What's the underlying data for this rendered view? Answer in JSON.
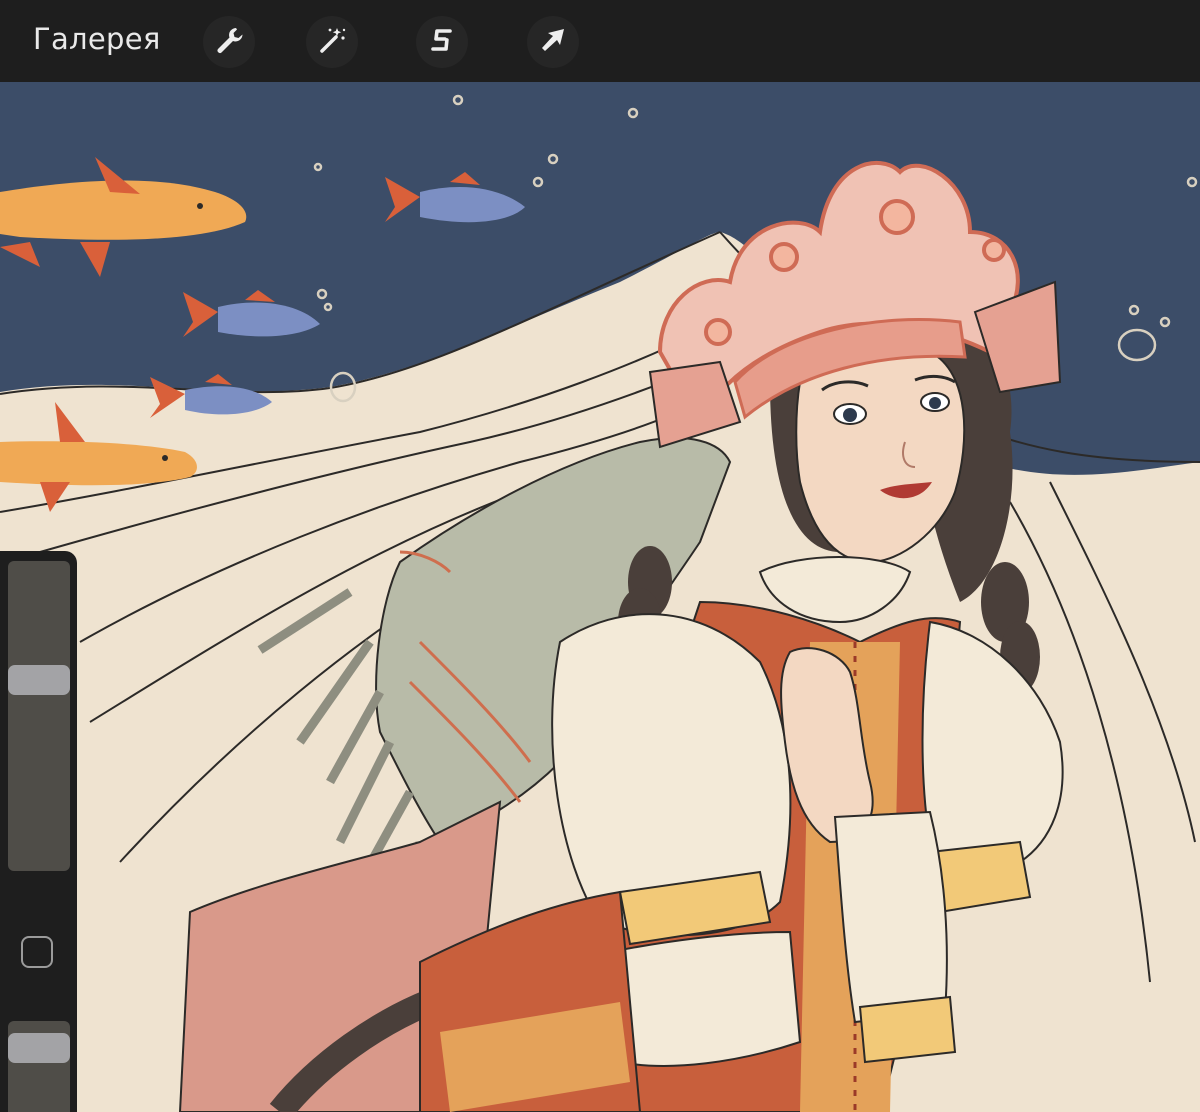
{
  "toolbar": {
    "gallery_label": "Галерея",
    "tools": [
      {
        "icon": "wrench-icon",
        "name": "actions"
      },
      {
        "icon": "magic-wand-icon",
        "name": "adjustments"
      },
      {
        "icon": "selection-s-icon",
        "name": "selection"
      },
      {
        "icon": "transform-arrow-icon",
        "name": "transform"
      }
    ]
  },
  "sidebar": {
    "brush_size_level": 0.37,
    "opacity_level": 0.15
  },
  "colors": {
    "toolbar_bg": "#1e1e1e",
    "sky": "#3c4d68",
    "veil": "#f1e6d4",
    "cloth_orange": "#c85f3c",
    "crown_pink": "#efb4a4",
    "fish_gold": "#f0a955"
  }
}
